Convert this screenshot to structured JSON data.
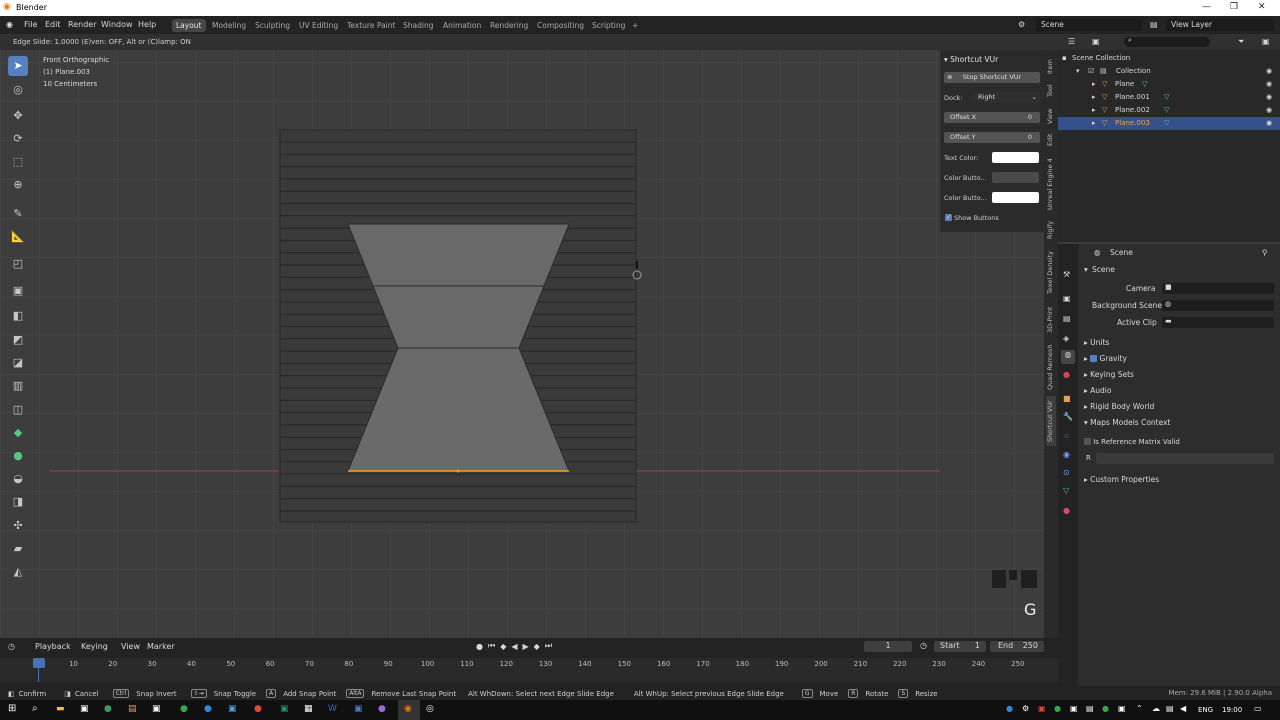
{
  "app": {
    "title": "Blender"
  },
  "menu": [
    "File",
    "Edit",
    "Render",
    "Window",
    "Help"
  ],
  "workspaces": [
    "Layout",
    "Modeling",
    "Sculpting",
    "UV Editing",
    "Texture Paint",
    "Shading",
    "Animation",
    "Rendering",
    "Compositing",
    "Scripting"
  ],
  "topright": {
    "scene": "Scene",
    "view_layer": "View Layer"
  },
  "header_text": "Edge Slide: 1.0000 (E)ven: OFF, Alt or (C)lamp: ON",
  "viewport": {
    "view": "Front Orthographic",
    "object": "(1) Plane.003",
    "scale": "10 Centimeters",
    "key_overlay": "G"
  },
  "npanel": {
    "title": "Shortcut VUr",
    "stop_button": "Stop Shortcut VUr",
    "dock_label": "Dock:",
    "dock_value": "Right",
    "offset_x_label": "Offset X",
    "offset_x_value": "0",
    "offset_y_label": "Offset Y",
    "offset_y_value": "0",
    "text_color_label": "Text Color:",
    "color_button_1_label": "Color Butto...",
    "color_button_2_label": "Color Butto...",
    "show_buttons_label": "Show Buttons"
  },
  "side_tabs": [
    "Item",
    "Tool",
    "View",
    "Edit",
    "Unreal Engine 4",
    "Rigify",
    "Texel Density",
    "3D-Print",
    "Quad Remesh",
    "Shortcut VUr"
  ],
  "outliner": {
    "root": "Scene Collection",
    "collection": "Collection",
    "items": [
      "Plane",
      "Plane.001",
      "Plane.002",
      "Plane.003"
    ]
  },
  "properties": {
    "header": "Scene",
    "section": "Scene",
    "camera_label": "Camera",
    "background_scene_label": "Background Scene",
    "active_clip_label": "Active Clip",
    "panels": [
      "Units",
      "Gravity",
      "Keying Sets",
      "Audio",
      "Rigid Body World",
      "Maps Models Context"
    ],
    "matrix_label": "Is Reference Matrix Valid",
    "r_label": "R",
    "custom_properties": "Custom Properties"
  },
  "timeline": {
    "playback": "Playback",
    "keying": "Keying",
    "view": "View",
    "marker": "Marker",
    "current_frame": "1",
    "start_label": "Start",
    "start_value": "1",
    "end_label": "End",
    "end_value": "250",
    "ticks": [
      "1",
      "10",
      "20",
      "30",
      "40",
      "50",
      "60",
      "70",
      "80",
      "90",
      "100",
      "110",
      "120",
      "130",
      "140",
      "150",
      "160",
      "170",
      "180",
      "190",
      "200",
      "210",
      "220",
      "230",
      "240",
      "250"
    ]
  },
  "statusbar": {
    "confirm": "Confirm",
    "cancel": "Cancel",
    "snap_invert": "Snap Invert",
    "snap_toggle": "Snap Toggle",
    "add_snap_point": "Add Snap Point",
    "remove_snap_point": "Remove Last Snap Point",
    "alt_wheel_down": "Alt WhDown: Select next Edge Slide Edge",
    "alt_wheel_up": "Alt WhUp: Select previous Edge Slide Edge",
    "move": "Move",
    "rotate": "Rotate",
    "resize": "Resize",
    "memory": "Mem: 29.6 MiB | 2.90.0 Alpha"
  },
  "taskbar": {
    "lang": "ENG",
    "time": "19:00"
  }
}
